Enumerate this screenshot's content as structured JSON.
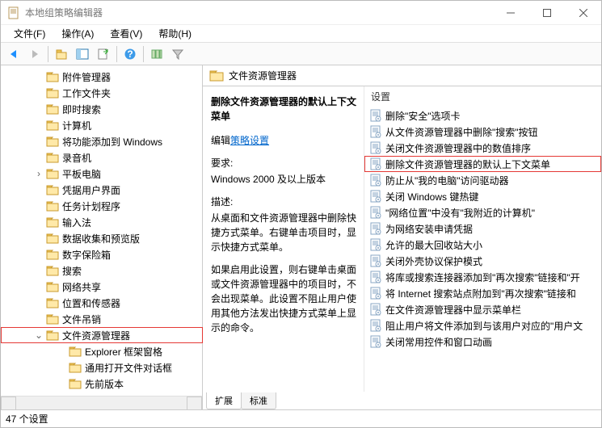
{
  "window": {
    "title": "本地组策略编辑器"
  },
  "menu": {
    "file": "文件(F)",
    "action": "操作(A)",
    "view": "查看(V)",
    "help": "帮助(H)"
  },
  "tree": {
    "items": [
      {
        "label": "附件管理器"
      },
      {
        "label": "工作文件夹"
      },
      {
        "label": "即时搜索"
      },
      {
        "label": "计算机"
      },
      {
        "label": "将功能添加到 Windows"
      },
      {
        "label": "录音机"
      },
      {
        "label": "平板电脑",
        "expander": ">"
      },
      {
        "label": "凭据用户界面"
      },
      {
        "label": "任务计划程序"
      },
      {
        "label": "输入法"
      },
      {
        "label": "数据收集和预览版"
      },
      {
        "label": "数字保险箱"
      },
      {
        "label": "搜索"
      },
      {
        "label": "网络共享"
      },
      {
        "label": "位置和传感器"
      },
      {
        "label": "文件吊销"
      },
      {
        "label": "文件资源管理器",
        "expander": "v",
        "selected": true
      },
      {
        "label": "Explorer 框架窗格",
        "child": true
      },
      {
        "label": "通用打开文件对话框",
        "child": true
      },
      {
        "label": "先前版本",
        "child": true
      }
    ]
  },
  "content": {
    "header": "文件资源管理器",
    "desc": {
      "title": "删除文件资源管理器的默认上下文菜单",
      "edit_prefix": "编辑",
      "edit_link": "策略设置",
      "req_label": "要求:",
      "req_value": "Windows 2000 及以上版本",
      "desc_label": "描述:",
      "desc_body1": "从桌面和文件资源管理器中删除快捷方式菜单。右键单击项目时，显示快捷方式菜单。",
      "desc_body2": "如果启用此设置，则右键单击桌面或文件资源管理器中的项目时，不会出现菜单。此设置不阻止用户使用其他方法发出快捷方式菜单上显示的命令。"
    },
    "settings_header": "设置",
    "settings": [
      "删除\"安全\"选项卡",
      "从文件资源管理器中删除\"搜索\"按钮",
      "关闭文件资源管理器中的数值排序",
      "删除文件资源管理器的默认上下文菜单",
      "防止从\"我的电脑\"访问驱动器",
      "关闭 Windows 键热键",
      "\"网络位置\"中没有\"我附近的计算机\"",
      "为网络安装申请凭据",
      "允许的最大回收站大小",
      "关闭外壳协议保护模式",
      "将库或搜索连接器添加到\"再次搜索\"链接和\"开",
      "将 Internet 搜索站点附加到\"再次搜索\"链接和",
      "在文件资源管理器中显示菜单栏",
      "阻止用户将文件添加到与该用户对应的\"用户文",
      "关闭常用控件和窗口动画"
    ],
    "highlighted_index": 3
  },
  "tabs": {
    "extended": "扩展",
    "standard": "标准"
  },
  "status": "47 个设置"
}
